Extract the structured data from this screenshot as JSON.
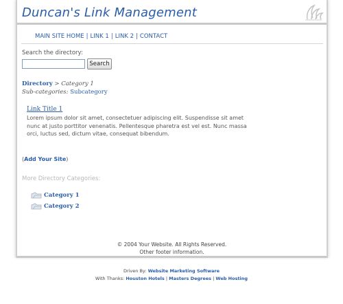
{
  "header": {
    "site_title": "Duncan's Link Management",
    "logo_icon": "swirl-logo-icon"
  },
  "nav": {
    "items": [
      {
        "label": "MAIN SITE HOME"
      },
      {
        "label": "LINK 1"
      },
      {
        "label": "LINK 2"
      },
      {
        "label": "CONTACT"
      }
    ],
    "separator": "|"
  },
  "search": {
    "label": "Search the directory:",
    "value": "",
    "placeholder": "",
    "button_label": "Search"
  },
  "breadcrumb": {
    "root": "Directory",
    "separator": ">",
    "current": "Category 1"
  },
  "subcategories": {
    "label": "Sub-categories:",
    "items": [
      "Subcategory"
    ]
  },
  "listing": {
    "title": "Link Title 1",
    "description": "Lorem ipsum dolor sit amet, consectetuer adipiscing elit. Suspendisse sit amet nunc at justo porttitor venenatis. Pellentesque pharetra est vel est. Nunc massa orci, luctus sed, dictum vitae, consequat bibendum."
  },
  "add_site": {
    "open": "(",
    "label": "Add Your Site",
    "close": ")"
  },
  "more_categories": {
    "label": "More Directory Categories:",
    "items": [
      {
        "label": "Category 1",
        "icon": "folder-icon"
      },
      {
        "label": "Category 2",
        "icon": "folder-icon"
      }
    ]
  },
  "footer": {
    "copyright": "© 2004 Your Website. All Rights Reserved.",
    "other": "Other footer information."
  },
  "credits": {
    "driven_prefix": "Driven By:",
    "driven_link": "Website Marketing Software",
    "thanks_prefix": "With Thanks:",
    "thanks_links": [
      "Houston Hotels",
      "Masters Degrees",
      "Web Hosting"
    ],
    "separator": "|"
  },
  "colors": {
    "link": "#2a5da8",
    "muted_label": "#b9b9b9",
    "border": "#c9c9c9"
  }
}
